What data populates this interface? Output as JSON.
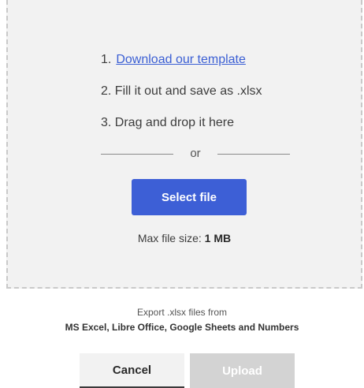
{
  "dropzone": {
    "steps": {
      "step1_number": "1.",
      "step1_link": "Download our template",
      "step2": "2. Fill it out and save as .xlsx",
      "step3": "3. Drag and drop it here"
    },
    "divider_text": "or",
    "select_button": "Select file",
    "max_size_label": "Max file size:",
    "max_size_value": "1 MB"
  },
  "export": {
    "line1": "Export .xlsx files from",
    "line2": "MS Excel, Libre Office, Google Sheets and Numbers"
  },
  "actions": {
    "cancel": "Cancel",
    "upload": "Upload"
  },
  "colors": {
    "primary": "#3d5fd6",
    "link": "#3b5fd4",
    "disabled": "#d3d3d3",
    "dropzone_bg": "#f2f2f2"
  }
}
